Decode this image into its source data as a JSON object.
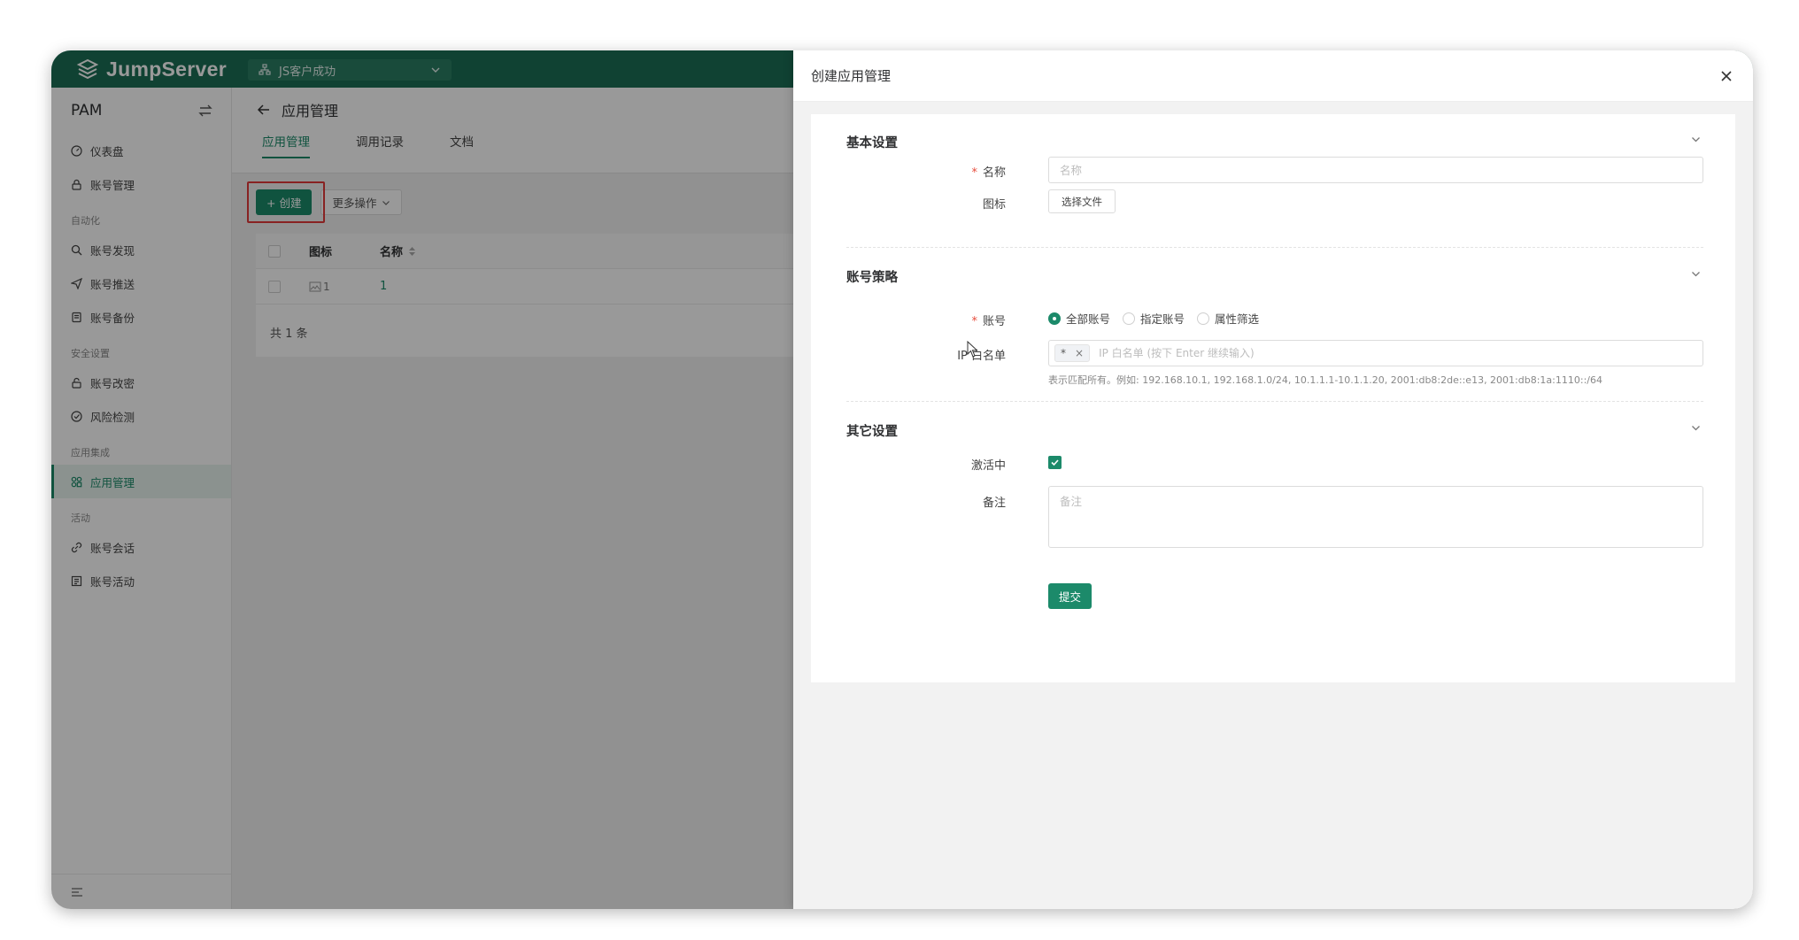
{
  "topbar": {
    "logo_text": "JumpServer",
    "org": "JS客户成功",
    "icons": {
      "logo": "jumpserver-logo-icon",
      "org": "org-icon",
      "chevron": "chevron-down-icon"
    }
  },
  "sidebar": {
    "title": "PAM",
    "switch_icon": "switch-icon",
    "top_items": [
      {
        "label": "仪表盘",
        "icon": "dashboard-icon"
      },
      {
        "label": "账号管理",
        "icon": "lock-icon"
      }
    ],
    "groups": [
      {
        "title": "自动化",
        "items": [
          {
            "label": "账号发现",
            "icon": "search-icon"
          },
          {
            "label": "账号推送",
            "icon": "send-icon"
          },
          {
            "label": "账号备份",
            "icon": "backup-icon"
          }
        ]
      },
      {
        "title": "安全设置",
        "items": [
          {
            "label": "账号改密",
            "icon": "lock-reset-icon"
          },
          {
            "label": "风险检测",
            "icon": "risk-icon"
          }
        ]
      },
      {
        "title": "应用集成",
        "items": [
          {
            "label": "应用管理",
            "icon": "apps-icon",
            "active": true
          }
        ]
      },
      {
        "title": "活动",
        "items": [
          {
            "label": "账号会话",
            "icon": "link-icon"
          },
          {
            "label": "账号活动",
            "icon": "activity-icon"
          }
        ]
      }
    ]
  },
  "main": {
    "title": "应用管理",
    "tabs": [
      {
        "label": "应用管理",
        "active": true
      },
      {
        "label": "调用记录"
      },
      {
        "label": "文档"
      }
    ],
    "toolbar": {
      "create_label": "+ 创建",
      "more_label": "更多操作"
    },
    "table": {
      "headers": [
        "图标",
        "名称"
      ],
      "rows": [
        {
          "icon_alt": "1",
          "name": "1"
        }
      ],
      "total": "共 1 条"
    }
  },
  "drawer": {
    "title": "创建应用管理",
    "sections": {
      "basic": "基本设置",
      "account_policy": "账号策略",
      "other": "其它设置"
    },
    "fields": {
      "name_label": "名称",
      "name_placeholder": "名称",
      "icon_label": "图标",
      "file_button": "选择文件",
      "account_label": "账号",
      "account_options": [
        "全部账号",
        "指定账号",
        "属性筛选"
      ],
      "ip_label": "IP 白名单",
      "ip_tag": "*",
      "ip_placeholder": "IP 白名单 (按下 Enter 继续输入)",
      "ip_help": "表示匹配所有。例如: 192.168.10.1, 192.168.1.0/24, 10.1.1.1-10.1.1.20, 2001:db8:2de::e13, 2001:db8:1a:1110::/64",
      "active_label": "激活中",
      "comment_label": "备注",
      "comment_placeholder": "备注",
      "submit": "提交"
    }
  },
  "colors": {
    "primary": "#1c8a6a",
    "topbar": "#1c6e55",
    "highlight": "#e33a3a"
  }
}
